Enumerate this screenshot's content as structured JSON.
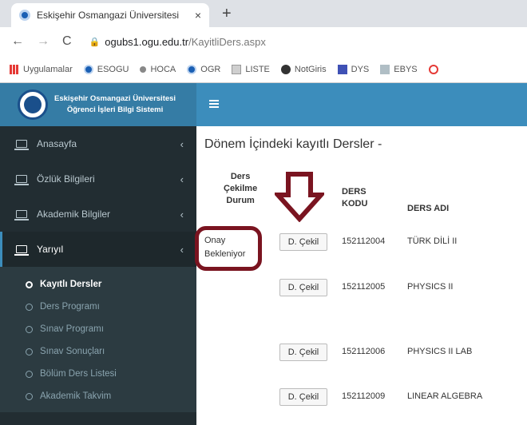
{
  "browser": {
    "tab_title": "Eskişehir Osmangazi Üniversitesi",
    "tab_close": "×",
    "new_tab": "+",
    "url_host": "ogubs1.ogu.edu.tr",
    "url_path": "/KayitliDers.aspx",
    "bookmarks": [
      {
        "label": "Uygulamalar",
        "icon": "apps-grid-icon"
      },
      {
        "label": "ESOGU",
        "icon": "esogu-logo-icon"
      },
      {
        "label": "HOCA",
        "icon": "dot-icon"
      },
      {
        "label": "OGR",
        "icon": "esogu-logo-icon"
      },
      {
        "label": "LISTE",
        "icon": "list-icon"
      },
      {
        "label": "NotGiris",
        "icon": "globe-icon"
      },
      {
        "label": "DYS",
        "icon": "dys-icon"
      },
      {
        "label": "EBYS",
        "icon": "ebys-icon"
      }
    ]
  },
  "brand": {
    "line1": "Eskişehir Osmangazi Üniversitesi",
    "line2": "Öğrenci İşleri Bilgi Sistemi"
  },
  "sidebar": {
    "items": [
      {
        "label": "Anasayfa"
      },
      {
        "label": "Özlük Bilgileri"
      },
      {
        "label": "Akademik Bilgiler"
      },
      {
        "label": "Yarıyıl"
      }
    ],
    "submenu": [
      {
        "label": "Kayıtlı Dersler"
      },
      {
        "label": "Ders Programı"
      },
      {
        "label": "Sınav Programı"
      },
      {
        "label": "Sınav Sonuçları"
      },
      {
        "label": "Bölüm Ders Listesi"
      },
      {
        "label": "Akademik Takvim"
      }
    ]
  },
  "main": {
    "title": "Dönem İçindeki kayıtlı Dersler -",
    "headers": {
      "status": [
        "Ders",
        "Çekilme",
        "Durum"
      ],
      "code": [
        "DERS",
        "KODU"
      ],
      "name": "DERS ADI"
    },
    "rows": [
      {
        "status": [
          "Onay",
          "Bekleniyor"
        ],
        "button": "D. Çekil",
        "code": "152112004",
        "name": "TÜRK DİLİ II"
      },
      {
        "status": [],
        "button": "D. Çekil",
        "code": "152112005",
        "name": "PHYSICS II"
      },
      {
        "status": [],
        "button": "D. Çekil",
        "code": "152112006",
        "name": "PHYSICS II LAB"
      },
      {
        "status": [],
        "button": "D. Çekil",
        "code": "152112009",
        "name": "LINEAR ALGEBRA"
      }
    ]
  },
  "colors": {
    "sidebar_bg": "#222d32",
    "header_bg": "#3c8dbc",
    "brand_bg": "#357ca5",
    "annotation": "#7a1420"
  }
}
